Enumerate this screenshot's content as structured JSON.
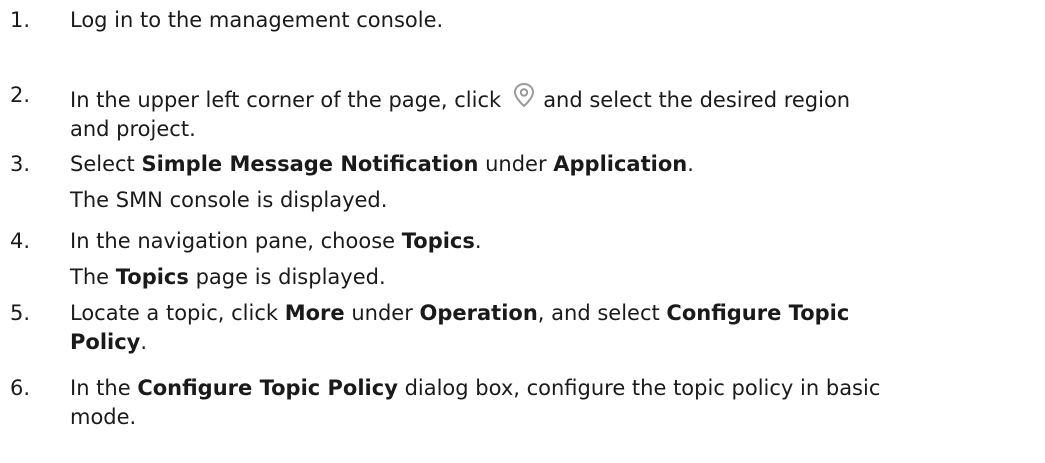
{
  "steps": [
    {
      "number": "1.",
      "text": "Log in to the management console."
    },
    {
      "number": "2.",
      "text_before_icon": "In the upper left corner of the page, click",
      "icon": "location-pin-icon",
      "text_after_icon": "and select the desired region",
      "text_line2": "and project."
    },
    {
      "number": "3.",
      "t1": "Select ",
      "b1": "Simple Message Notification",
      "t2": " under ",
      "b2": "Application",
      "t3": ".",
      "result": "The SMN console is displayed."
    },
    {
      "number": "4.",
      "t1": "In the navigation pane, choose ",
      "b1": "Topics",
      "t2": ".",
      "result_t1": "The ",
      "result_b1": "Topics",
      "result_t2": " page is displayed."
    },
    {
      "number": "5.",
      "t1": "Locate a topic, click ",
      "b1": "More",
      "t2": " under ",
      "b2": "Operation",
      "t3": ", and select ",
      "b3": "Configure Topic",
      "b3_line2": "Policy",
      "t4": "."
    },
    {
      "number": "6.",
      "t1": "In the ",
      "b1": "Configure Topic Policy",
      "t2": " dialog box, configure the topic policy in basic",
      "line2": "mode."
    }
  ],
  "colors": {
    "text": "#1a1a1a",
    "icon": "#9a9a9a"
  }
}
